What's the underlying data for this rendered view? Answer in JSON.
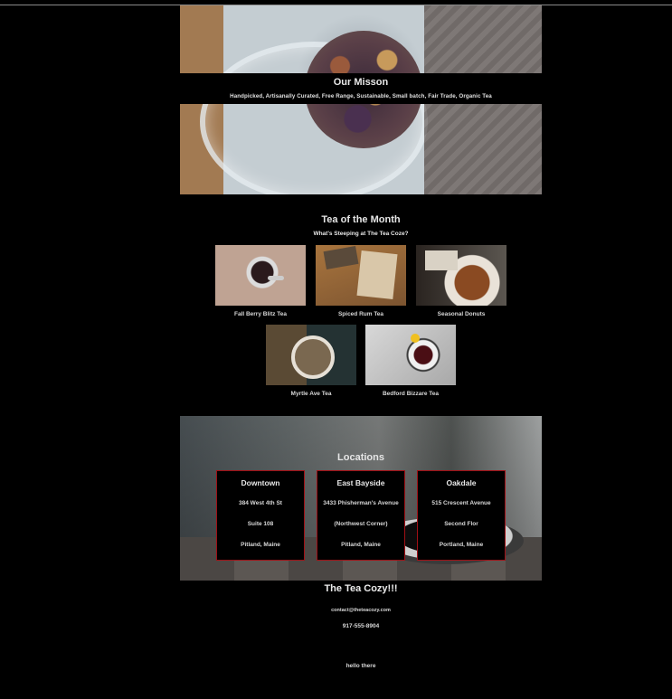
{
  "mission": {
    "title": "Our Misson",
    "subtitle": "Handpicked, Artisanally Curated, Free Range, Sustainable, Small batch, Fair Trade, Organic Tea"
  },
  "tea_of_month": {
    "title": "Tea of the Month",
    "subtitle": "What's Steeping at The Tea Coze?",
    "items": [
      {
        "label": "Fall Berry Blitz Tea"
      },
      {
        "label": "Spiced Rum Tea"
      },
      {
        "label": "Seasonal Donuts"
      },
      {
        "label": "Myrtle Ave Tea"
      },
      {
        "label": "Bedford Bizzare Tea"
      }
    ]
  },
  "locations": {
    "title": "Locations",
    "items": [
      {
        "name": "Downtown",
        "line1": "384 West 4th St",
        "line2": "Suite 108",
        "line3": "Pitland, Maine"
      },
      {
        "name": "East Bayside",
        "line1": "3433 Phisherman's Avenue",
        "line2": "(Northwest Corner)",
        "line3": "Pitland, Maine"
      },
      {
        "name": "Oakdale",
        "line1": "515 Crescent Avenue",
        "line2": "Second Flor",
        "line3": "Portland, Maine"
      }
    ]
  },
  "footer": {
    "brand": "The Tea Cozy!!!",
    "email": "contact@theteacozy.com",
    "phone": "917-555-8904",
    "note": "hello there"
  },
  "colors": {
    "background": "#000000",
    "box_border": "#a01016",
    "text": "#dddddd"
  }
}
